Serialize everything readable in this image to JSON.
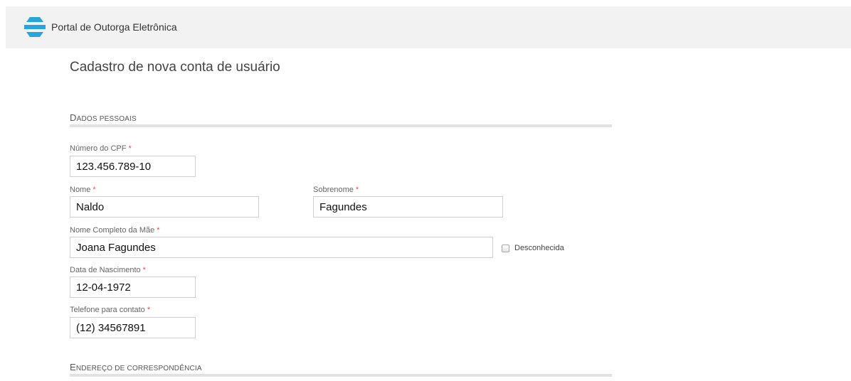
{
  "header": {
    "app_title": "Portal de Outorga Eletrônica",
    "logo_icon": "portal-logo-icon",
    "brand_color": "#2aa4dc"
  },
  "page": {
    "title": "Cadastro de nova conta de usuário"
  },
  "sections": {
    "personal": "Dados pessoais",
    "address": "Endereço de correspondência"
  },
  "required_mark": "*",
  "fields": {
    "cpf": {
      "label": "Número do CPF",
      "value": "123.456.789-10"
    },
    "nome": {
      "label": "Nome",
      "value": "Naldo"
    },
    "sobrenome": {
      "label": "Sobrenome",
      "value": "Fagundes"
    },
    "mae": {
      "label": "Nome Completo da Mãe",
      "value": "Joana Fagundes"
    },
    "desconhecida": {
      "label": "Desconhecida",
      "checked": false
    },
    "nascimento": {
      "label": "Data de Nascimento",
      "value": "12-04-1972"
    },
    "telefone": {
      "label": "Telefone para contato",
      "value": "(12) 34567891"
    }
  }
}
